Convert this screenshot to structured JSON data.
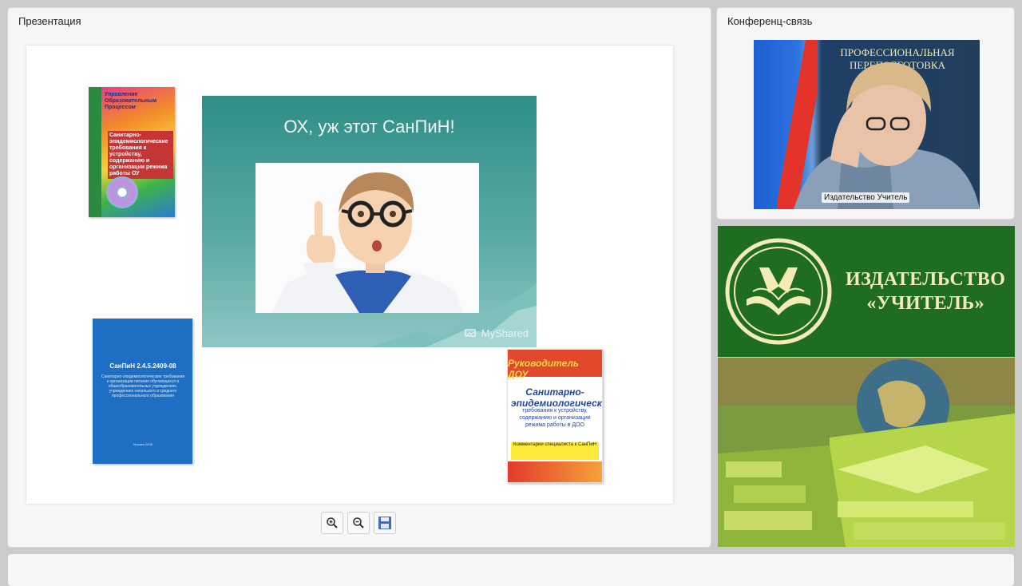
{
  "presentation": {
    "title": "Презентация",
    "slide": {
      "hero_title": "ОХ, уж этот СанПиН!",
      "hero_brand": "MyShared",
      "book1": {
        "title": "Управление Образовательным Процессом",
        "subtitle": "Санитарно-эпидемиологические требования к устройству, содержанию и организации режима работы ОУ"
      },
      "book2": {
        "title": "СанПиН 2.4.5.2409-08",
        "subtitle": "Санитарно-эпидемиологические требования к организации питания обучающихся в общеобразовательных учреждениях, учреждениях начального и среднего профессионального образования",
        "footer": "Москва 2008"
      },
      "book3": {
        "series": "Руководитель ДОУ",
        "title": "Санитарно-эпидемиологические",
        "subtitle": "требования к устройству, содержанию и организации режима работы в ДОО",
        "note": "Комментарии специалиста к СанПиН"
      }
    },
    "toolbar": {
      "zoom_in_icon": "zoom-in-icon",
      "zoom_out_icon": "zoom-out-icon",
      "save_icon": "save-icon"
    }
  },
  "conference": {
    "title": "Конференц-связь",
    "banner": "ПРОФЕССИОНАЛЬНАЯ ПЕРЕПОДГОТОВКА",
    "participant_label": "Издательство Учитель"
  },
  "publisher": {
    "line1": "ИЗДАТЕЛЬСТВО",
    "line2": "«УЧИТЕЛЬ»"
  },
  "colors": {
    "panel_bg": "#f6f6f6",
    "page_bg": "#c9cbcc",
    "publisher_green": "#1f6e1f",
    "publisher_text": "#f4ecb8",
    "hero_teal": "#2e8e86"
  }
}
